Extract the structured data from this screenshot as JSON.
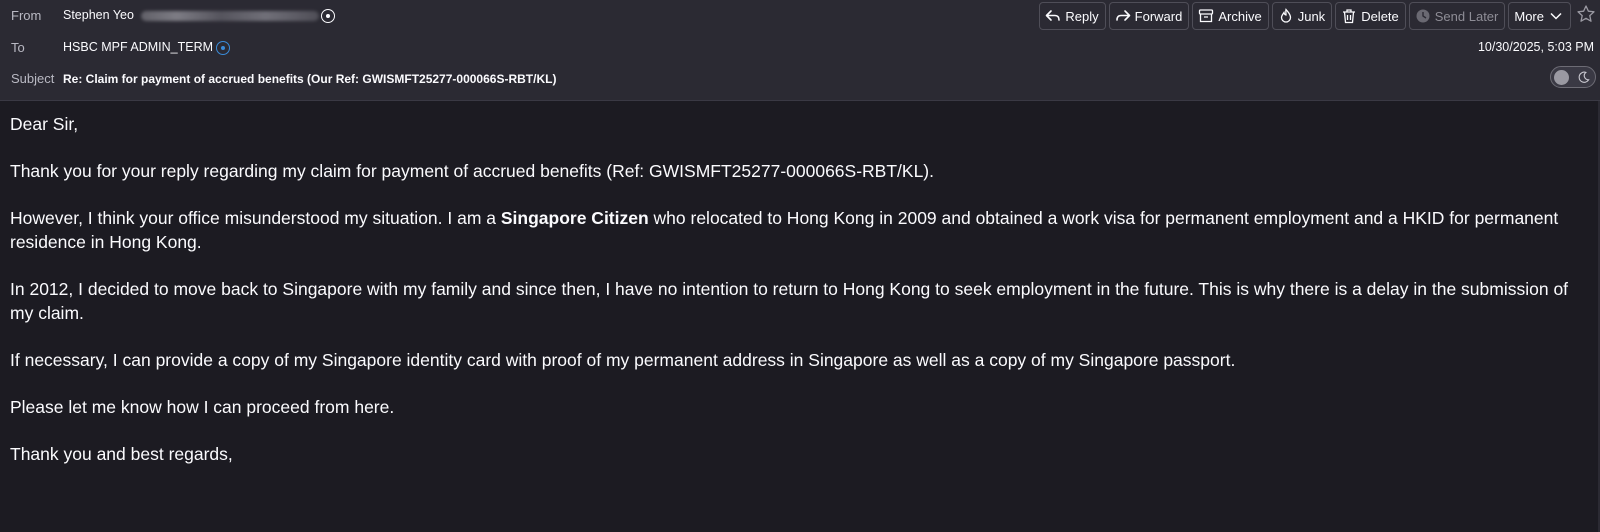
{
  "header": {
    "from_label": "From",
    "from_name": "Stephen Yeo",
    "to_label": "To",
    "to_name": "HSBC MPF ADMIN_TERM",
    "subject_label": "Subject",
    "subject": "Re: Claim for payment of accrued benefits (Our Ref: GWISMFT25277-000066S-RBT/KL)",
    "date": "10/30/2025, 5:03 PM"
  },
  "toolbar": {
    "reply": "Reply",
    "forward": "Forward",
    "archive": "Archive",
    "junk": "Junk",
    "delete": "Delete",
    "send_later": "Send Later",
    "more": "More"
  },
  "body": {
    "greeting": "Dear Sir,",
    "p1": "Thank you for your reply regarding my claim for payment of accrued benefits (Ref: GWISMFT25277-000066S-RBT/KL).",
    "p2_before": "However, I think your office misunderstood my situation. I am a ",
    "p2_bold": "Singapore Citizen",
    "p2_after": " who relocated to Hong Kong in 2009 and obtained a work visa for permanent employment and a HKID for permanent residence in Hong Kong.",
    "p3": "In 2012, I decided to move back to Singapore with my family and since then, I have no intention to return to Hong Kong to seek employment in the future. This is why there is a delay in the submission of my claim.",
    "p4": "If necessary, I can provide a copy of my Singapore identity card with proof of my permanent address in Singapore as well as a copy of my Singapore passport.",
    "p5": "Please let me know how I can proceed from here.",
    "closing": "Thank you and best regards,"
  },
  "colors": {
    "header_bg": "#2b2a33",
    "body_bg": "#1c1b22",
    "text": "#fbfbfe",
    "contact_accent": "#3a8bd8"
  },
  "icons": [
    "reply-icon",
    "forward-icon",
    "archive-icon",
    "junk-icon",
    "delete-icon",
    "send-later-icon",
    "chevron-down-icon",
    "star-icon",
    "contact-icon",
    "moon-icon"
  ]
}
